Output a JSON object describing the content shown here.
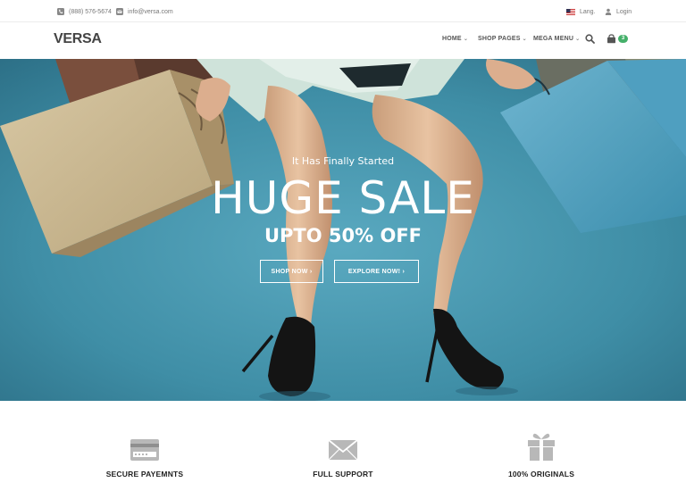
{
  "topbar": {
    "phone": "(888) 576-5674",
    "email": "info@versa.com",
    "lang": "Lang.",
    "login": "Login"
  },
  "navbar": {
    "logo": "VERSA",
    "items": [
      "HOME",
      "SHOP PAGES",
      "MEGA MENU"
    ],
    "cart_count": "3"
  },
  "hero": {
    "eyebrow": "It Has Finally Started",
    "title": "HUGE SALE",
    "subtitle": "UPTO 50% OFF",
    "buttons": [
      "SHOP NOW",
      "EXPLORE NOW!"
    ]
  },
  "features": [
    {
      "label": "SECURE PAYEMNTS",
      "icon": "credit-card-icon"
    },
    {
      "label": "FULL SUPPORT",
      "icon": "envelope-icon"
    },
    {
      "label": "100% ORIGINALS",
      "icon": "gift-icon"
    }
  ],
  "colors": {
    "accent": "#45b06a",
    "hero_bg": "#3f90a8",
    "feature_icon": "#b8b8b8"
  }
}
